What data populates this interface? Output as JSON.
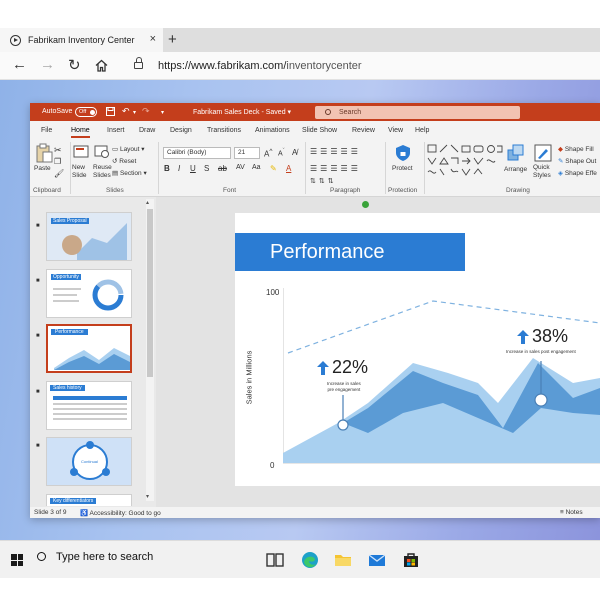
{
  "browser": {
    "tab_title": "Fabrikam Inventory Center",
    "tab_close": "×",
    "new_tab": "+",
    "url_host": "https://www.fabrikam.com/",
    "url_path": "inventorycenter",
    "back": "←",
    "forward": "→",
    "refresh": "↻"
  },
  "ppt": {
    "autosave_label": "AutoSave",
    "autosave_state": "Off",
    "doc_title": "Fabrikam Sales Deck  -  Saved  ▾",
    "search_placeholder": "Search",
    "tabs": [
      "File",
      "Home",
      "Insert",
      "Draw",
      "Design",
      "Transitions",
      "Animations",
      "Slide Show",
      "Review",
      "View",
      "Help"
    ],
    "active_tab": "Home",
    "ribbon": {
      "paste": "Paste",
      "new_slide": "New\nSlide",
      "reuse_slides": "Reuse\nSlides",
      "layout": "Layout",
      "reset": "Reset",
      "section": "Section",
      "font_name": "Calibri (Body)",
      "font_size": "21",
      "protect": "Protect",
      "arrange": "Arrange",
      "quick_styles": "Quick\nStyles",
      "shape_fill": "Shape Fill",
      "shape_outline": "Shape Out",
      "shape_effects": "Shape Effe",
      "groups": [
        "Clipboard",
        "Slides",
        "Font",
        "Paragraph",
        "Protection",
        "Drawing"
      ]
    },
    "thumbnails": [
      {
        "title": "Sales Proposal"
      },
      {
        "title": "Opportunity"
      },
      {
        "title": "Performance"
      },
      {
        "title": "Sales history"
      },
      {
        "title": "Continual"
      },
      {
        "title": "Key differentiators"
      }
    ],
    "slide": {
      "title": "Performance",
      "ylabel": "Sales in Millions",
      "ytick_top": "100",
      "ytick_bottom": "0",
      "callout1_value": "22%",
      "callout1_text": "Increase in sales\npre engagement",
      "callout2_value": "38%",
      "callout2_text": "Increase in sales post engagement"
    },
    "status": {
      "slide_info": "Slide 3 of 9",
      "accessibility": "Accessibility: Good to go",
      "notes": "Notes"
    }
  },
  "taskbar": {
    "search_placeholder": "Type here to search"
  },
  "colors": {
    "ppt_red": "#c43e1c",
    "slide_blue": "#2b7cd3",
    "area_light": "#a9d0f0",
    "area_mid": "#5b9bd5"
  }
}
